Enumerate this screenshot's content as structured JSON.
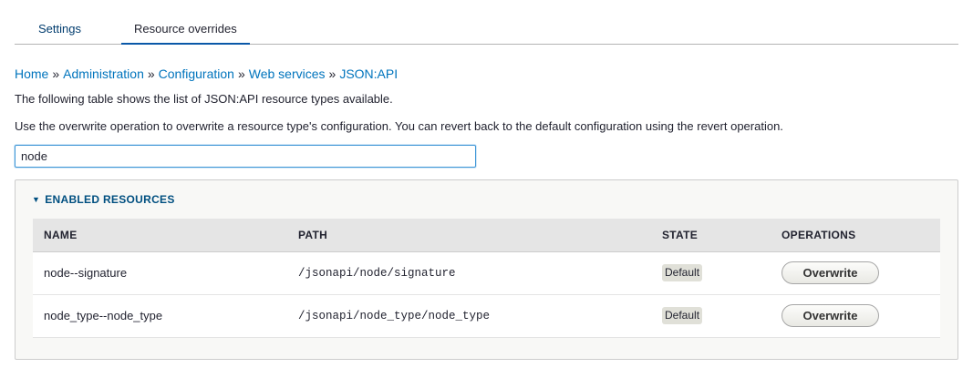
{
  "tabs": [
    {
      "label": "Settings",
      "active": false
    },
    {
      "label": "Resource overrides",
      "active": true
    }
  ],
  "breadcrumb": {
    "items": [
      "Home",
      "Administration",
      "Configuration",
      "Web services",
      "JSON:API"
    ],
    "separator": "»"
  },
  "descriptions": [
    "The following table shows the list of JSON:API resource types available.",
    "Use the overwrite operation to overwrite a resource type's configuration. You can revert back to the default configuration using the revert operation."
  ],
  "filter": {
    "value": "node"
  },
  "panel": {
    "title": "ENABLED RESOURCES",
    "expanded": true,
    "columns": [
      "NAME",
      "PATH",
      "STATE",
      "OPERATIONS"
    ],
    "rows": [
      {
        "name": "node--signature",
        "path": "/jsonapi/node/signature",
        "state": "Default",
        "operation": "Overwrite"
      },
      {
        "name": "node_type--node_type",
        "path": "/jsonapi/node_type/node_type",
        "state": "Default",
        "operation": "Overwrite"
      }
    ]
  },
  "colors": {
    "link": "#0074bd",
    "summary": "#004f80",
    "tab_underline": "#0a58a8",
    "focus_border": "#4097d7"
  }
}
